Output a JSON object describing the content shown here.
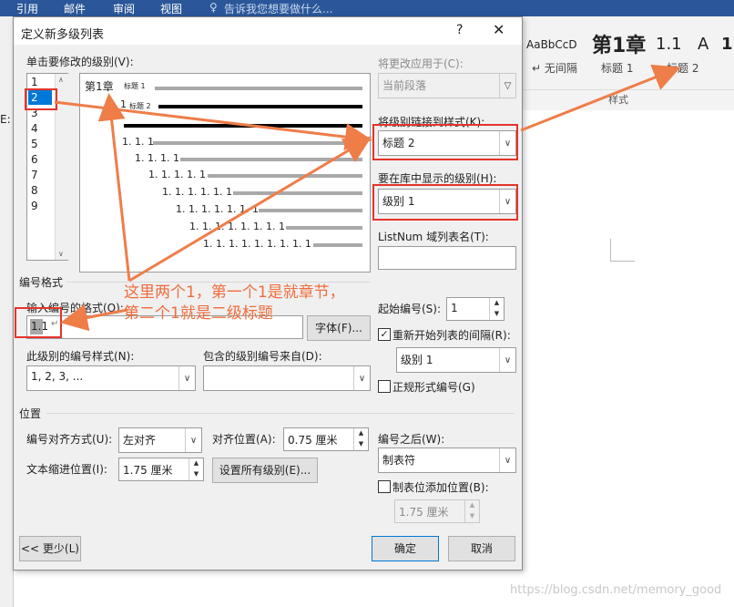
{
  "ribbon": {
    "tabs": [
      "引用",
      "邮件",
      "审阅",
      "视图"
    ],
    "tell_me": "告诉我您想要做什么...",
    "styles": [
      {
        "preview": "AaBbCcD",
        "name": "↵ 无间隔"
      },
      {
        "preview": "第1章",
        "name": "标题 1"
      },
      {
        "preview": "1.1",
        "name": "标题 2"
      },
      {
        "preview": "A",
        "name": ""
      },
      {
        "preview": "1",
        "name": ""
      }
    ],
    "group_label": "样式",
    "left_cut": "E:"
  },
  "dialog": {
    "title": "定义新多级列表",
    "help": "?",
    "close": "✕",
    "click_level_label": "单击要修改的级别(V):",
    "levels": [
      "1",
      "2",
      "3",
      "4",
      "5",
      "6",
      "7",
      "8",
      "9"
    ],
    "selected_level": "2",
    "preview": {
      "heading1": "第1章",
      "heading1_tag": "标题 1",
      "heading2": "1. 1",
      "heading2_tag": "标题 2",
      "rows": [
        "1. 1. 1",
        "1. 1. 1. 1",
        "1. 1. 1. 1. 1",
        "1. 1. 1. 1. 1. 1",
        "1. 1. 1. 1. 1. 1. 1",
        "1. 1. 1. 1. 1. 1. 1. 1",
        "1. 1. 1. 1. 1. 1. 1. 1. 1"
      ]
    },
    "apply_to_label": "将更改应用于(C):",
    "apply_to_value": "当前段落",
    "link_style_label": "将级别链接到样式(K):",
    "link_style_value": "标题 2",
    "gallery_level_label": "要在库中显示的级别(H):",
    "gallery_level_value": "级别 1",
    "listnum_label": "ListNum 域列表名(T):",
    "listnum_value": "",
    "number_format_section": "编号格式",
    "enter_format_label": "输入编号的格式(O):",
    "format_value": "1.1",
    "format_mark": "↵",
    "font_button": "字体(F)...",
    "number_style_label": "此级别的编号样式(N):",
    "number_style_value": "1, 2, 3, ...",
    "include_from_label": "包含的级别编号来自(D):",
    "include_from_value": "",
    "start_at_label": "起始编号(S):",
    "start_at_value": "1",
    "restart_label": "重新开始列表的间隔(R):",
    "restart_checked": true,
    "restart_value": "级别 1",
    "legal_label": "正规形式编号(G)",
    "legal_checked": false,
    "position_section": "位置",
    "align_label": "编号对齐方式(U):",
    "align_value": "左对齐",
    "align_at_label": "对齐位置(A):",
    "align_at_value": "0.75 厘米",
    "indent_label": "文本缩进位置(I):",
    "indent_value": "1.75 厘米",
    "set_all_button": "设置所有级别(E)...",
    "follow_label": "编号之后(W):",
    "follow_value": "制表符",
    "tab_stop_label": "制表位添加位置(B):",
    "tab_stop_checked": false,
    "tab_stop_value": "1.75 厘米",
    "less_button": "<< 更少(L)",
    "ok_button": "确定",
    "cancel_button": "取消"
  },
  "annotation": {
    "line1": "这里两个1，第一个1是就章节，",
    "line2": "第二个1就是二级标题",
    "color": "#ef6c3c"
  },
  "watermark": "https://blog.csdn.net/memory_good"
}
